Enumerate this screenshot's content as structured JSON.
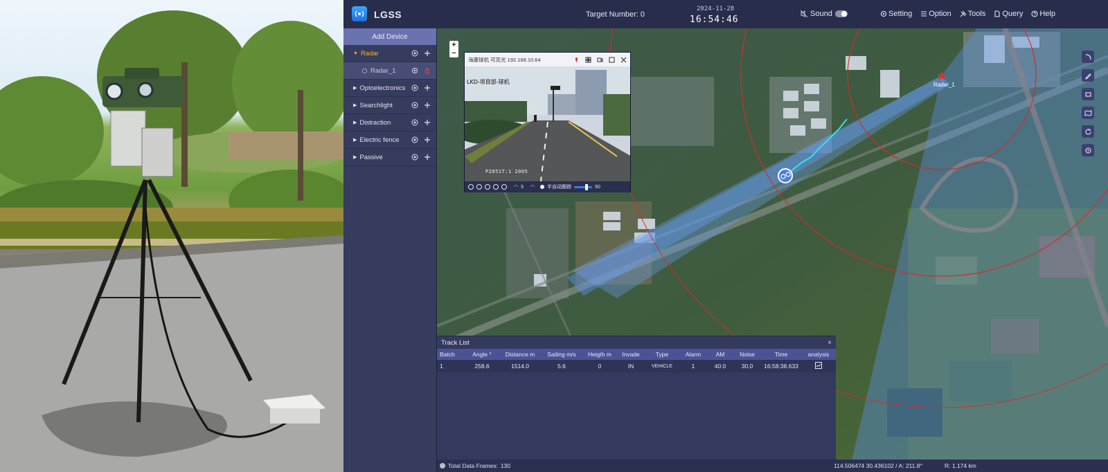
{
  "app": {
    "title": "LGSS",
    "target_number_label": "Target Number:",
    "target_number": "0",
    "date": "2024-11-28",
    "time": "16:54:46",
    "sound_label": "Sound",
    "sound_on": false,
    "menus": [
      {
        "label": "Setting",
        "icon": "gear-icon"
      },
      {
        "label": "Option",
        "icon": "list-icon"
      },
      {
        "label": "Tools",
        "icon": "tools-icon"
      },
      {
        "label": "Query",
        "icon": "document-icon"
      },
      {
        "label": "Help",
        "icon": "help-icon"
      }
    ]
  },
  "sidebar": {
    "add_device": "Add Device",
    "items": [
      {
        "label": "Radar",
        "expanded": true
      },
      {
        "label": "Radar_1",
        "child": true
      },
      {
        "label": "Optoelectronics"
      },
      {
        "label": "Searchlight"
      },
      {
        "label": "Distraction"
      },
      {
        "label": "Electric fence"
      },
      {
        "label": "Passive"
      }
    ]
  },
  "map": {
    "radar_label": "Radar_1",
    "zoom_in": "+",
    "zoom_out": "−",
    "tools": [
      "curve-icon",
      "pencil-icon",
      "rectangle-icon",
      "map-icon",
      "refresh-icon",
      "settings-icon"
    ]
  },
  "camera": {
    "title": "海康球机 可见光 192.168.10.64",
    "osd_top": "LKD-项目部-球机",
    "osd_bottom": "P2051T:1  2005",
    "speed_value": "5",
    "tracking_label": "半自动跟踪",
    "slider_value": "50"
  },
  "track_list": {
    "title": "Track List",
    "close": "×",
    "columns": [
      "Batch",
      "Angle °",
      "Distance m",
      "Sailing m/s",
      "Heigth m",
      "Invade",
      "Type",
      "Alarm",
      "AM",
      "Noise",
      "Time",
      "analysis"
    ],
    "rows": [
      [
        "1",
        "258.6",
        "1514.0",
        "5.6",
        "0",
        "IN",
        "VEHICLE",
        "1",
        "40.0",
        "30.0",
        "16:58:38.633",
        ""
      ]
    ]
  },
  "status": {
    "frames_label": "Total Data Frames:",
    "frames": "130",
    "coords": "114.506474  30.436102 /  A:  211.8°",
    "range": "R:  1.174 km"
  },
  "colors": {
    "accent": "#4b5396",
    "active": "#f5b533",
    "radar_ring": "#d42b2b",
    "coverage": "#4a86e8"
  }
}
